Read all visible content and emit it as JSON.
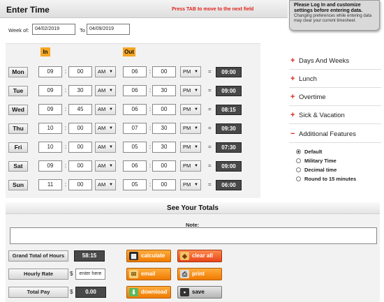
{
  "header": {
    "title": "Enter Time",
    "tab_hint": "Press TAB to move to the next field"
  },
  "login_tip": {
    "bold": "Please Log In and customize settings before entering data.",
    "body": "Changing preferences while entering data may clear your current timesheet."
  },
  "week": {
    "label": "Week of:",
    "from": "04/02/2019",
    "to_label": "To",
    "to": "04/09/2019"
  },
  "columns": {
    "in": "In",
    "out": "Out"
  },
  "colon": ":",
  "equals": "=",
  "days": [
    {
      "day": "Mon",
      "in_h": "09",
      "in_m": "00",
      "in_ap": "AM",
      "out_h": "06",
      "out_m": "00",
      "out_ap": "PM",
      "total": "09:00"
    },
    {
      "day": "Tue",
      "in_h": "09",
      "in_m": "30",
      "in_ap": "AM",
      "out_h": "06",
      "out_m": "30",
      "out_ap": "PM",
      "total": "09:00"
    },
    {
      "day": "Wed",
      "in_h": "09",
      "in_m": "45",
      "in_ap": "AM",
      "out_h": "06",
      "out_m": "00",
      "out_ap": "PM",
      "total": "08:15"
    },
    {
      "day": "Thu",
      "in_h": "10",
      "in_m": "00",
      "in_ap": "AM",
      "out_h": "07",
      "out_m": "30",
      "out_ap": "PM",
      "total": "09:30"
    },
    {
      "day": "Fri",
      "in_h": "10",
      "in_m": "00",
      "in_ap": "AM",
      "out_h": "05",
      "out_m": "30",
      "out_ap": "PM",
      "total": "07:30"
    },
    {
      "day": "Sat",
      "in_h": "09",
      "in_m": "00",
      "in_ap": "AM",
      "out_h": "06",
      "out_m": "00",
      "out_ap": "PM",
      "total": "09:00"
    },
    {
      "day": "Sun",
      "in_h": "11",
      "in_m": "00",
      "in_ap": "AM",
      "out_h": "05",
      "out_m": "00",
      "out_ap": "PM",
      "total": "06:00"
    }
  ],
  "menu": {
    "items": [
      "Days And Weeks",
      "Lunch",
      "Overtime",
      "Sick & Vacation",
      "Additional Features"
    ],
    "expanded_index": 4,
    "options": [
      "Default",
      "Military Time",
      "Decimal time",
      "Round to 15 minutes"
    ],
    "selected_option": 0
  },
  "totals": {
    "heading": "See Your Totals",
    "note_label": "Note:",
    "grand_total_label": "Grand Total of Hours",
    "grand_total": "58:15",
    "hourly_rate_label": "Hourly Rate",
    "currency": "$",
    "hourly_rate_placeholder": "enter here",
    "total_pay_label": "Total Pay",
    "total_pay": "0.00"
  },
  "actions": {
    "calculate": "calculate",
    "clear_all": "clear all",
    "email": "email",
    "print": "print",
    "download": "download",
    "save": "save"
  },
  "colors": {
    "accent_orange": "#f5a623",
    "alert_red": "#e0231b",
    "dark_total": "#484848"
  }
}
